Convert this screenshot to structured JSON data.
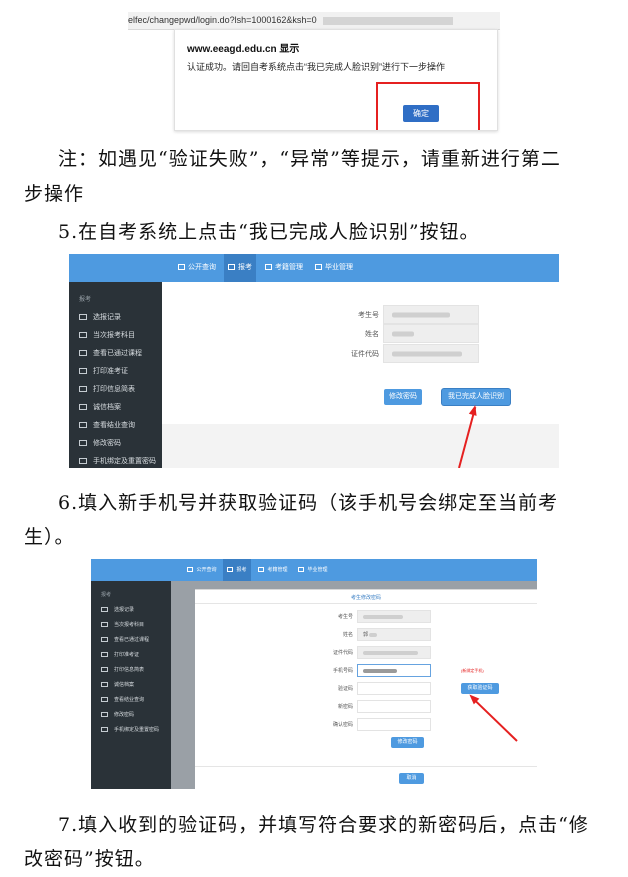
{
  "figure1": {
    "url_text": "elfec/changepwd/login.do?lsh=1000162&ksh=0",
    "dialog_host": "www.eeagd.edu.cn 显示",
    "dialog_message": "认证成功。请回自考系统点击“我已完成人脸识别”进行下一步操作",
    "ok_button": "确定"
  },
  "paragraphs": {
    "note_line1": "注：如遇见“验证失败”，“异常”等提示，请重新进行第二",
    "note_line2": "步操作",
    "step5": "5.在自考系统上点击“我已完成人脸识别”按钮。",
    "step6_line1": "6.填入新手机号并获取验证码（该手机号会绑定至当前考",
    "step6_line2": "生）。",
    "step7_line1": "7.填入收到的验证码，并填写符合要求的新密码后，点击“修",
    "step7_line2": "改密码”按钮。"
  },
  "app": {
    "nav": [
      "公开查询",
      "报考",
      "考籍管理",
      "毕业管理"
    ],
    "sidebar_header": "报考",
    "sidebar_items": [
      "选报记录",
      "当次报考科目",
      "查看已通过课程",
      "打印准考证",
      "打印信息简表",
      "诚信档案",
      "查看结业查询",
      "修改密码",
      "手机绑定及重置密码"
    ]
  },
  "figure2": {
    "labels": [
      "考生号",
      "姓名",
      "证件代码"
    ],
    "btn_change_password": "修改密码",
    "btn_face_done": "我已完成人脸识别"
  },
  "figure3": {
    "panel_title": "考生修改密码",
    "labels": [
      "考生号",
      "姓名",
      "证件代码",
      "手机号码",
      "验证码",
      "新密码",
      "确认密码"
    ],
    "name_value": "郭",
    "phone_hint": "(新绑定手机)",
    "btn_get_code": "获取验证码",
    "btn_change_password": "修改密码",
    "btn_cancel": "取消"
  },
  "colors": {
    "nav_blue": "#4e9ae0",
    "sidebar": "#2a3238",
    "annotation_red": "#e52020",
    "dialog_button": "#2f6ec5"
  }
}
